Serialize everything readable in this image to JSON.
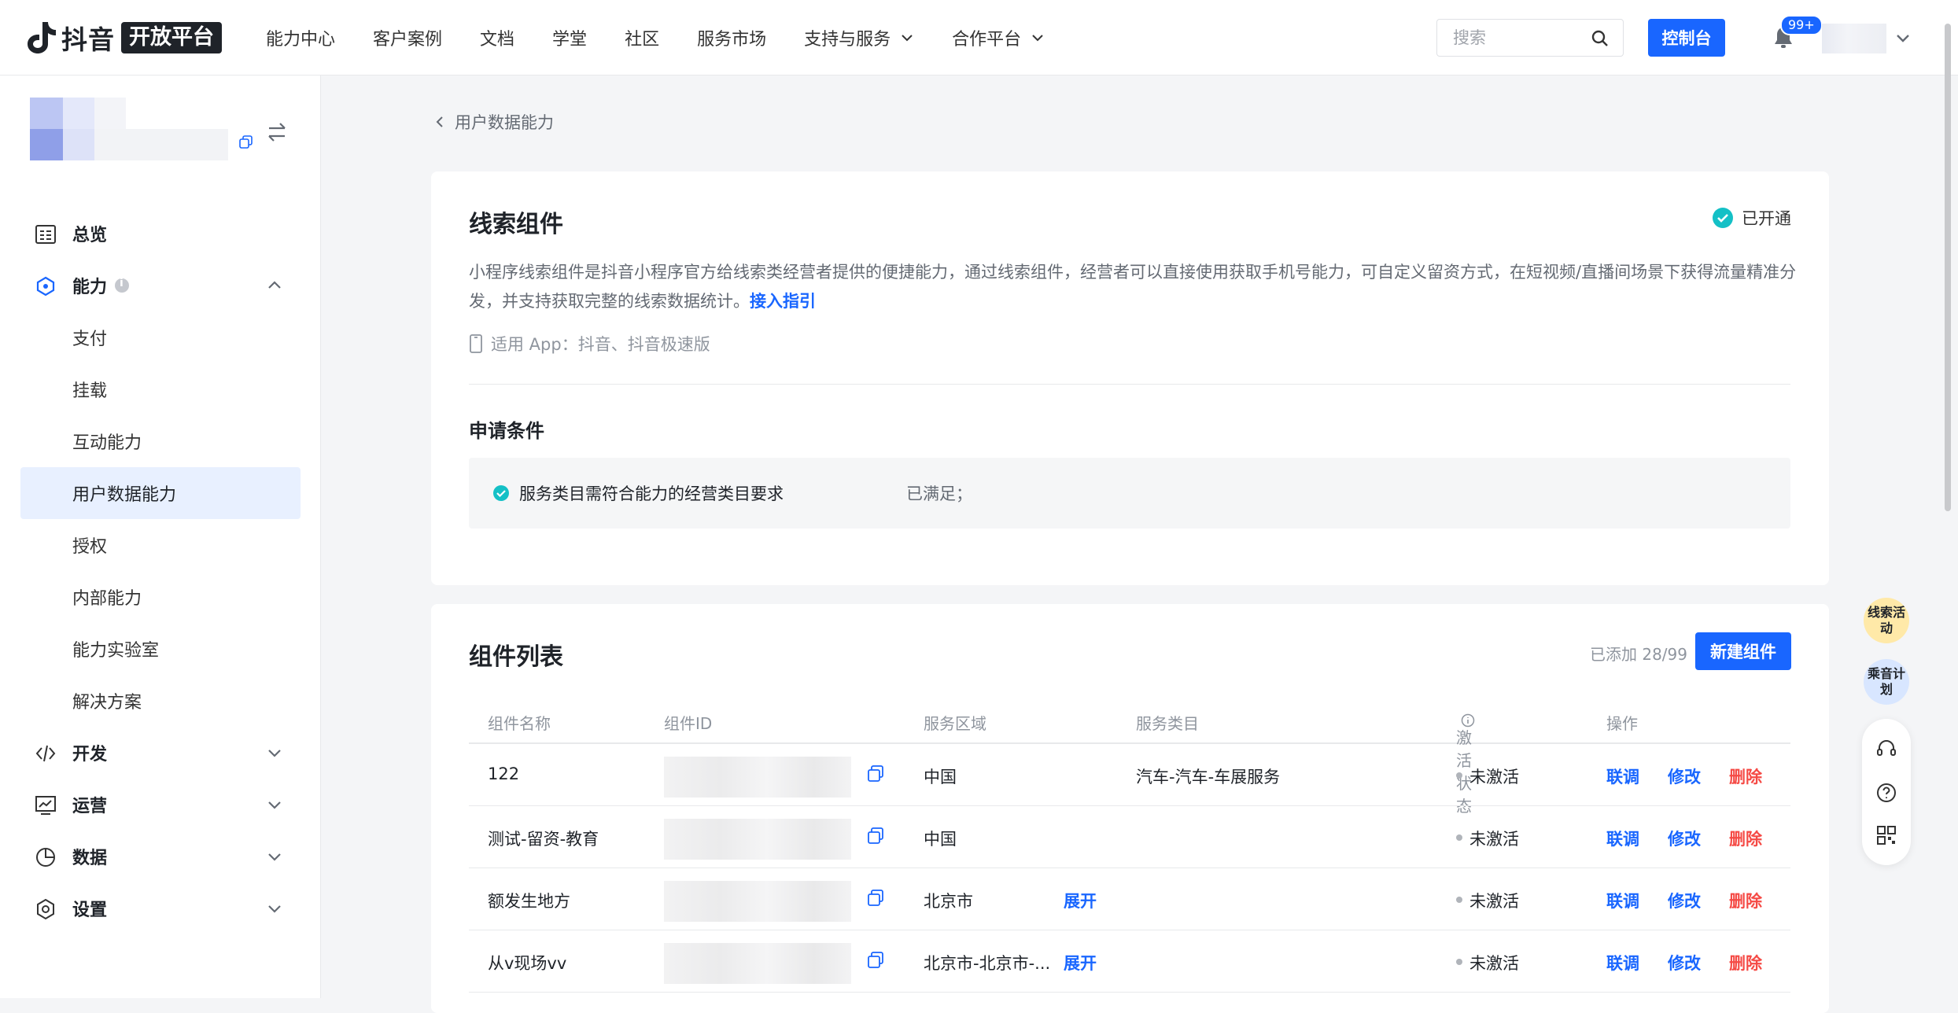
{
  "header": {
    "logo_text": "抖音",
    "logo_badge": "开放平台",
    "nav": [
      "能力中心",
      "客户案例",
      "文档",
      "学堂",
      "社区",
      "服务市场"
    ],
    "nav_dropdowns": [
      "支持与服务",
      "合作平台"
    ],
    "search_placeholder": "搜索",
    "console_label": "控制台",
    "notification_count": "99+"
  },
  "sidebar": {
    "top_items": {
      "overview": "总览",
      "capability": "能力",
      "develop": "开发",
      "operate": "运营",
      "data": "数据",
      "settings": "设置"
    },
    "sub_items": [
      "支付",
      "挂载",
      "互动能力",
      "用户数据能力",
      "授权",
      "内部能力",
      "能力实验室",
      "解决方案"
    ],
    "active_item": "用户数据能力"
  },
  "breadcrumb": {
    "back_label": "用户数据能力"
  },
  "component_card": {
    "title": "线索组件",
    "status": "已开通",
    "description": "小程序线索组件是抖音小程序官方给线索类经营者提供的便捷能力，通过线索组件，经营者可以直接使用获取手机号能力，可自定义留资方式，在短视频/直播间场景下获得流量精准分发，并支持获取完整的线索数据统计。",
    "guide_link": "接入指引",
    "apps": "适用 App：抖音、抖音极速版",
    "conditions_title": "申请条件",
    "condition_text": "服务类目需符合能力的经营类目要求",
    "condition_status": "已满足；"
  },
  "list_card": {
    "title": "组件列表",
    "added_count": "已添加 28/99",
    "new_button": "新建组件",
    "columns": [
      "组件名称",
      "组件ID",
      "服务区域",
      "服务类目",
      "激活状态",
      "操作"
    ],
    "rows": [
      {
        "name": "122",
        "region": "中国",
        "expand": "",
        "category": "汽车-汽车-车展服务",
        "status": "未激活"
      },
      {
        "name": "测试-留资-教育",
        "region": "中国",
        "expand": "",
        "category": "",
        "status": "未激活"
      },
      {
        "name": "额发生地方",
        "region": "北京市",
        "expand": "展开",
        "category": "",
        "status": "未激活"
      },
      {
        "name": "从v现场vv",
        "region": "北京市-北京市-...",
        "expand": "展开",
        "category": "",
        "status": "未激活"
      }
    ],
    "actions": {
      "debug": "联调",
      "edit": "修改",
      "delete": "删除"
    }
  },
  "float": {
    "badge1": "线索活动",
    "badge2": "乘音计划"
  },
  "colors": {
    "accent": "#1966ff",
    "danger": "#f54a45",
    "success": "#14c0c6"
  }
}
